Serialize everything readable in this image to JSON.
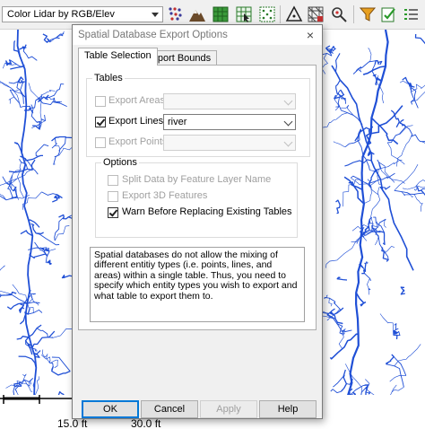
{
  "toolbar": {
    "layer_select": "Color Lidar by RGB/Elev",
    "icons": [
      "render-dots-icon",
      "mountain-icon",
      "grid-green-icon",
      "grid-select-icon",
      "dotted-grid-icon",
      "triangle-icon",
      "mesh-icon",
      "magnify-point-icon",
      "funnel-icon",
      "edit-check-icon",
      "checklist-icon"
    ]
  },
  "scale": {
    "label_1": "15.0 ft",
    "label_2": "30.0 ft"
  },
  "dialog": {
    "title": "Spatial Database Export Options",
    "close": "×",
    "tabs": [
      "Table Selection",
      "Export Bounds"
    ],
    "tables_label": "Tables",
    "rows": [
      {
        "label": "Export Areas:",
        "checked": false,
        "enabled": false,
        "value": ""
      },
      {
        "label": "Export Lines:",
        "checked": true,
        "enabled": true,
        "value": "river"
      },
      {
        "label": "Export Points:",
        "checked": false,
        "enabled": false,
        "value": ""
      }
    ],
    "options_label": "Options",
    "options": [
      {
        "label": "Split Data by Feature Layer Name",
        "checked": false,
        "enabled": false
      },
      {
        "label": "Export 3D Features",
        "checked": false,
        "enabled": false
      },
      {
        "label": "Warn Before Replacing Existing Tables",
        "checked": true,
        "enabled": true
      }
    ],
    "info": "Spatial databases do not allow the mixing of different entitiy types (i.e. points, lines, and areas) within a single table. Thus, you need to specify which entity types you wish to export and what table to export them to.",
    "buttons": {
      "ok": "OK",
      "cancel": "Cancel",
      "apply": "Apply",
      "help": "Help"
    }
  },
  "colors": {
    "river": "#1f4fd6",
    "accent": "#0078d7"
  }
}
